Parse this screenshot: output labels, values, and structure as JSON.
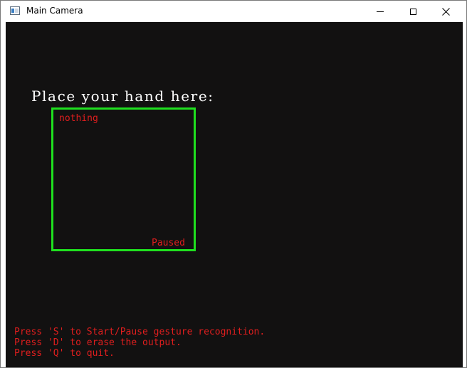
{
  "window": {
    "title": "Main Camera",
    "icon": "opencv-window-icon",
    "controls": {
      "minimize_icon": "minimize-icon",
      "maximize_icon": "maximize-icon",
      "close_icon": "close-icon"
    }
  },
  "camera": {
    "headline": "Place your hand here:",
    "prediction": "nothing",
    "status": "Paused",
    "instructions": [
      "Press 'S' to Start/Pause gesture recognition.",
      "Press 'D' to erase the output.",
      "Press 'Q' to quit."
    ],
    "colors": {
      "background": "#121111",
      "roi_border": "#1fe01f",
      "overlay_text": "#e01e1e",
      "headline_text": "#ffffff"
    }
  }
}
